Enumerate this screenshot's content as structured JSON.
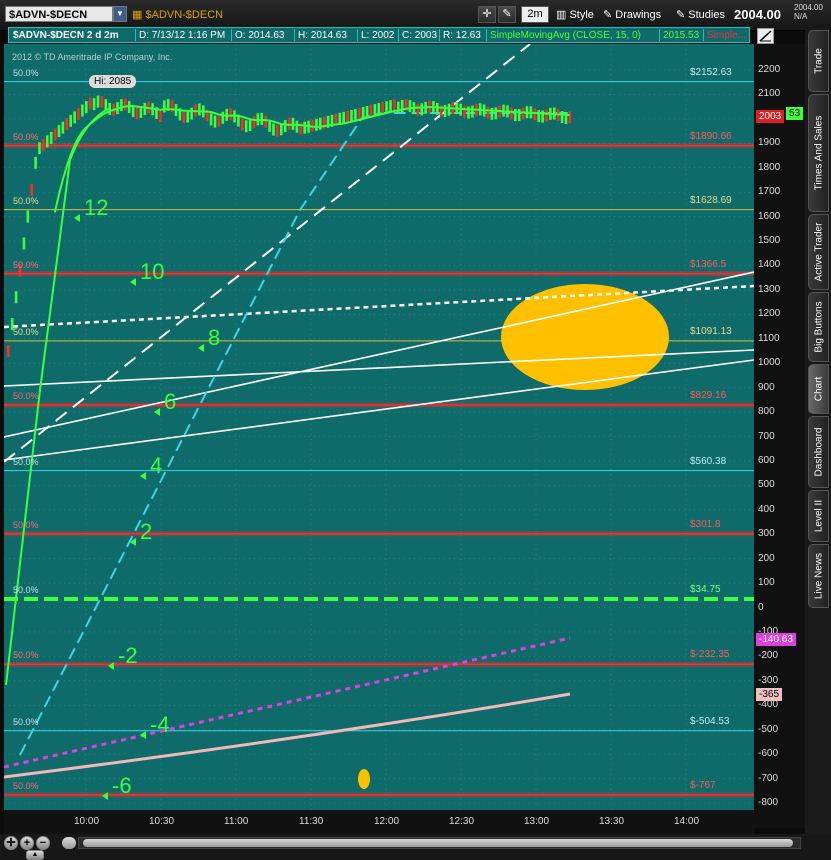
{
  "toolbar": {
    "symbol": "$ADVN-$DECN",
    "study_name": "$ADVN-$DECN",
    "aggregation": "2m",
    "style_label": "Style",
    "drawings_label": "Drawings",
    "studies_label": "Studies",
    "last_price": "2004.00",
    "last_small_price": "2004.00",
    "last_small_change": "N/A"
  },
  "info_bar": {
    "title": "$ADVN-$DECN 2 d 2m",
    "date": "D: 7/13/12 1:16 PM",
    "open": "O: 2014.63",
    "high": "H: 2014.63",
    "low": "L: 2002",
    "close": "C: 2003",
    "range": "R: 12.63",
    "sma_label": "SimpleMovingAvg (CLOSE, 15, 0)",
    "sma_value": "2015.53",
    "sma_extra": "Simple..."
  },
  "chart": {
    "copyright": "2012 © TD Ameritrade IP Company, Inc.",
    "high_bubble": "Hi: 2085",
    "price_tag_current": "2003",
    "price_tag_sma": "53",
    "price_tag_magenta": "-140.63",
    "price_tag_pink": "-365",
    "colors": {
      "background": "#0f6a6a",
      "price": "#3cff3c",
      "sma": "#3cff3c",
      "red_level": "#ff2a2a",
      "cyan_level": "#3ad7e8",
      "yellow_level": "#d6c23a",
      "highlight": "#ffc000",
      "magenta": "#e040e0",
      "pink": "#f0b8b8"
    }
  },
  "chart_data": {
    "type": "line",
    "y_ticks": [
      "2200",
      "2100",
      "2000",
      "1900",
      "1800",
      "1700",
      "1600",
      "1500",
      "1400",
      "1300",
      "1200",
      "1100",
      "1000",
      "900",
      "800",
      "700",
      "600",
      "500",
      "400",
      "300",
      "200",
      "100",
      "0",
      "-100",
      "-200",
      "-300",
      "-400",
      "-500",
      "-600",
      "-700",
      "-800"
    ],
    "ylim": [
      -840,
      2250
    ],
    "x_ticks": [
      "10:00",
      "10:30",
      "11:00",
      "11:30",
      "12:00",
      "12:30",
      "13:00",
      "13:30",
      "14:00"
    ],
    "fib_levels": [
      {
        "pct": "50.0%",
        "value": 2152.63,
        "label": "$2152.63",
        "color": "#3ad7e8"
      },
      {
        "pct": "50.0%",
        "value": 1890.66,
        "label": "$1890.66",
        "color": "#ff2a2a"
      },
      {
        "pct": "50.0%",
        "value": 1628.69,
        "label": "$1628.69",
        "color": "#d6c23a"
      },
      {
        "pct": "50.0%",
        "value": 1366.5,
        "label": "$1366.5",
        "color": "#ff2a2a"
      },
      {
        "pct": "50.0%",
        "value": 1091.13,
        "label": "$1091.13",
        "color": "#d6c23a"
      },
      {
        "pct": "50.0%",
        "value": 829.16,
        "label": "$829.16",
        "color": "#ff2a2a"
      },
      {
        "pct": "50.0%",
        "value": 560.38,
        "label": "$560.38",
        "color": "#3ad7e8"
      },
      {
        "pct": "50.0%",
        "value": 301.8,
        "label": "$301.8",
        "color": "#ff2a2a"
      },
      {
        "pct": "50.0%",
        "value": 34.75,
        "label": "$34.75",
        "color": "#3cff3c"
      },
      {
        "pct": "50.0%",
        "value": -232.35,
        "label": "$-232.35",
        "color": "#ff2a2a"
      },
      {
        "pct": "50.0%",
        "value": -504.53,
        "label": "$-504.53",
        "color": "#3ad7e8"
      },
      {
        "pct": "50.0%",
        "value": -767,
        "label": "$-767",
        "color": "#ff2a2a"
      }
    ],
    "annotations": [
      {
        "text": "12",
        "x": 1,
        "y": 1600
      },
      {
        "text": "10",
        "x": 2,
        "y": 1350
      },
      {
        "text": "8",
        "x": 3,
        "y": 1110
      },
      {
        "text": "6",
        "x": 4,
        "y": 840
      },
      {
        "text": "4",
        "x": 5,
        "y": 600
      },
      {
        "text": "2",
        "x": 6,
        "y": 270
      },
      {
        "text": "-2",
        "x": 7,
        "y": -230
      },
      {
        "text": "-4",
        "x": 8,
        "y": -510
      },
      {
        "text": "-6",
        "x": 9,
        "y": -780
      }
    ],
    "high": 2085,
    "current": 2003,
    "sma": 2015.53,
    "magenta_end": -140.63,
    "pink_end": -365
  },
  "sidetabs": [
    "Trade",
    "Times And Sales",
    "Active Trader",
    "Big Buttons",
    "Chart",
    "Dashboard",
    "Level II",
    "Live News"
  ]
}
